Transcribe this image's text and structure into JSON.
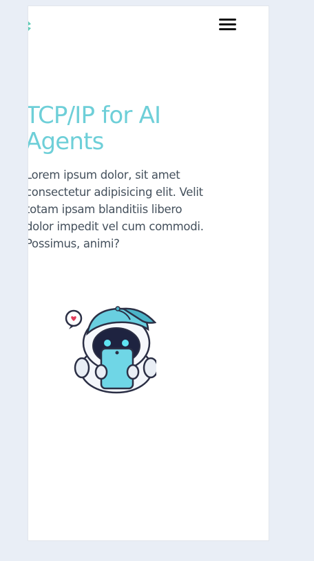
{
  "header": {
    "logo_icon": "leaf-logo-icon",
    "menu_icon": "hamburger-menu-icon"
  },
  "hero": {
    "title": "TCP/IP for AI Agents",
    "body": "Lorem ipsum dolor, sit amet consectetur adipisicing elit. Velit totam ipsam blanditiis libero dolor impedit vel cum commodi. Possimus, animi?",
    "illustration_icon": "robot-with-phone-illustration"
  },
  "colors": {
    "accent": "#6ecfd8",
    "text": "#44505c",
    "page_bg": "#e9eef6",
    "card_bg": "#ffffff"
  }
}
